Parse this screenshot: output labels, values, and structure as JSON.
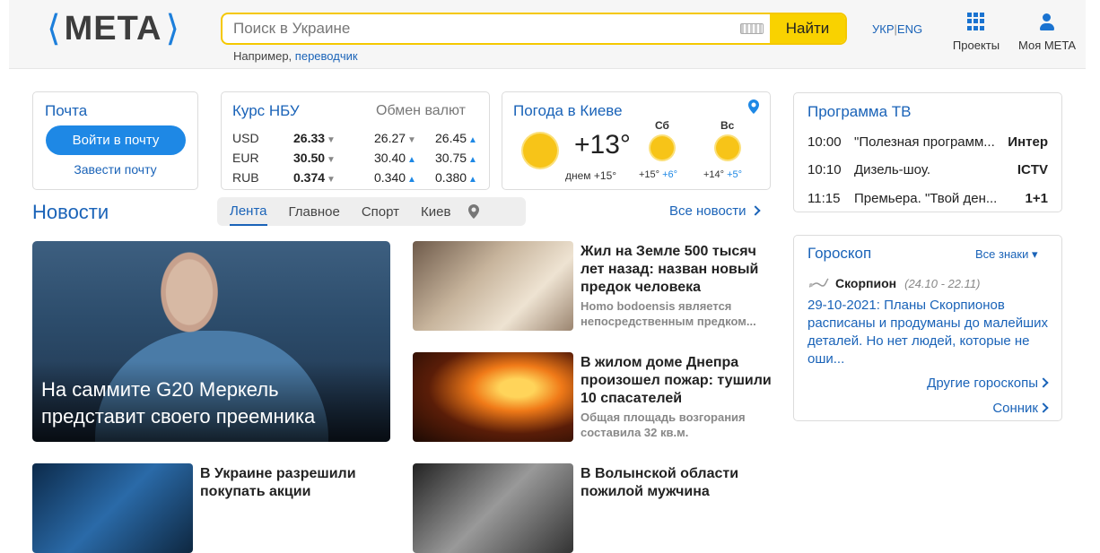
{
  "header": {
    "logo_text": "META",
    "search_placeholder": "Поиск в Украине",
    "search_button": "Найти",
    "hint_prefix": "Например,",
    "hint_link": "переводчик",
    "lang_ukr": "УКР",
    "lang_sep": "|",
    "lang_eng": "ENG",
    "projects_label": "Проекты",
    "my_meta_label": "Моя META",
    "icons": {
      "keyboard": "keyboard-icon",
      "projects": "grid-icon",
      "user": "user-icon"
    }
  },
  "mail": {
    "title": "Почта",
    "login_button": "Войти в почту",
    "signup_link": "Завести почту"
  },
  "rates": {
    "title": "Курс НБУ",
    "exchange_title": "Обмен валют",
    "rows": [
      {
        "currency": "USD",
        "nbu": "26.33",
        "nbu_trend": "▼",
        "buy": "26.27",
        "buy_trend": "▼",
        "sell": "26.45",
        "sell_trend": "▲"
      },
      {
        "currency": "EUR",
        "nbu": "30.50",
        "nbu_trend": "▼",
        "buy": "30.40",
        "buy_trend": "▲",
        "sell": "30.75",
        "sell_trend": "▲"
      },
      {
        "currency": "RUB",
        "nbu": "0.374",
        "nbu_trend": "▼",
        "buy": "0.340",
        "buy_trend": "▲",
        "sell": "0.380",
        "sell_trend": "▲"
      }
    ]
  },
  "weather": {
    "title": "Погода в Киеве",
    "now_temp": "+13°",
    "day_note": "днем +15°",
    "days": [
      {
        "name": "Сб",
        "day": "+15°",
        "night": "+6°"
      },
      {
        "name": "Вс",
        "day": "+14°",
        "night": "+5°"
      }
    ],
    "icons": {
      "location": "location-pin-icon",
      "sun": "sun-icon"
    }
  },
  "tv": {
    "title": "Программа ТВ",
    "rows": [
      {
        "time": "10:00",
        "show": "\"Полезная программ...",
        "channel": "Интер"
      },
      {
        "time": "10:10",
        "show": "Дизель-шоу.",
        "channel": "ICTV"
      },
      {
        "time": "11:15",
        "show": "Премьера. \"Твой ден...",
        "channel": "1+1"
      }
    ]
  },
  "horoscope": {
    "title": "Гороскоп",
    "all_signs": "Все знаки ▾",
    "sign": "Скорпион",
    "dates": "(24.10 - 22.11)",
    "text": "29-10-2021: Планы Скорпионов расписаны и продуманы до малейших деталей. Но нет людей, которые не оши...",
    "more": "Другие гороскопы",
    "compat": "Сонник"
  },
  "news": {
    "title": "Новости",
    "tabs": [
      "Лента",
      "Главное",
      "Спорт",
      "Киев"
    ],
    "all_news": "Все новости",
    "hero_caption": "На саммите G20 Меркель представит своего преемника",
    "items": [
      {
        "headline": "Жил на Земле 500 тысяч лет назад: назван новый предок человека",
        "summary": "Homo bodoensis является непосредственным предком..."
      },
      {
        "headline": "В жилом доме Днепра произошел пожар: тушили 10 спасателей",
        "summary": "Общая площадь возгорания составила 32 кв.м."
      },
      {
        "headline": "В Украине разрешили покупать акции",
        "summary": ""
      },
      {
        "headline": "В Волынской области пожилой мужчина",
        "summary": ""
      }
    ]
  }
}
